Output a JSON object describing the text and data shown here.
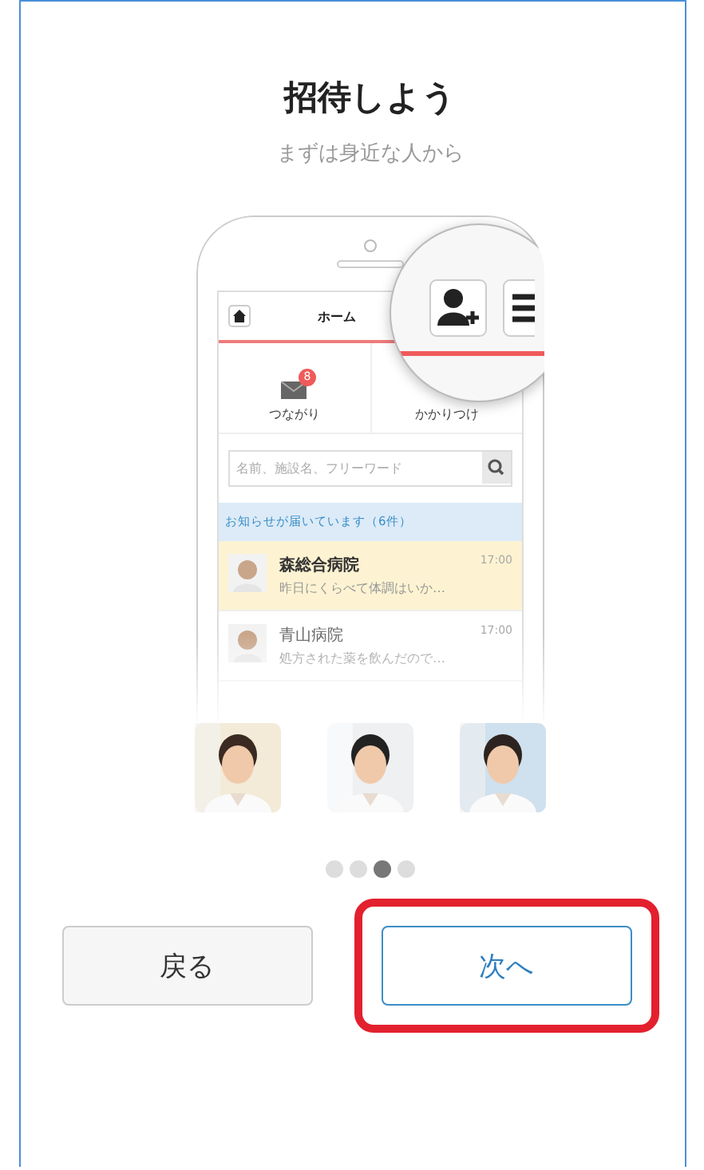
{
  "title": "招待しよう",
  "subtitle": "まずは身近な人から",
  "phone": {
    "header_title": "ホーム",
    "tabs": [
      {
        "label": "つながり",
        "badge": "8"
      },
      {
        "label": "かかりつけ"
      }
    ],
    "search": {
      "placeholder": "名前、施設名、フリーワード"
    },
    "notice": "お知らせが届いています（6件）",
    "messages": [
      {
        "name": "森総合病院",
        "time": "17:00",
        "preview": "昨日にくらべて体調はいか…",
        "unread": true
      },
      {
        "name": "青山病院",
        "time": "17:00",
        "preview": "処方された薬を飲んだので…",
        "unread": false
      }
    ]
  },
  "pager": [
    {
      "selected": false
    },
    {
      "selected": false
    },
    {
      "selected": true
    },
    {
      "selected": false
    }
  ],
  "buttons": [
    {
      "label": "戻る",
      "kind": "secondary",
      "highlighted": false
    },
    {
      "label": "次へ",
      "kind": "primary",
      "highlighted": true
    }
  ]
}
